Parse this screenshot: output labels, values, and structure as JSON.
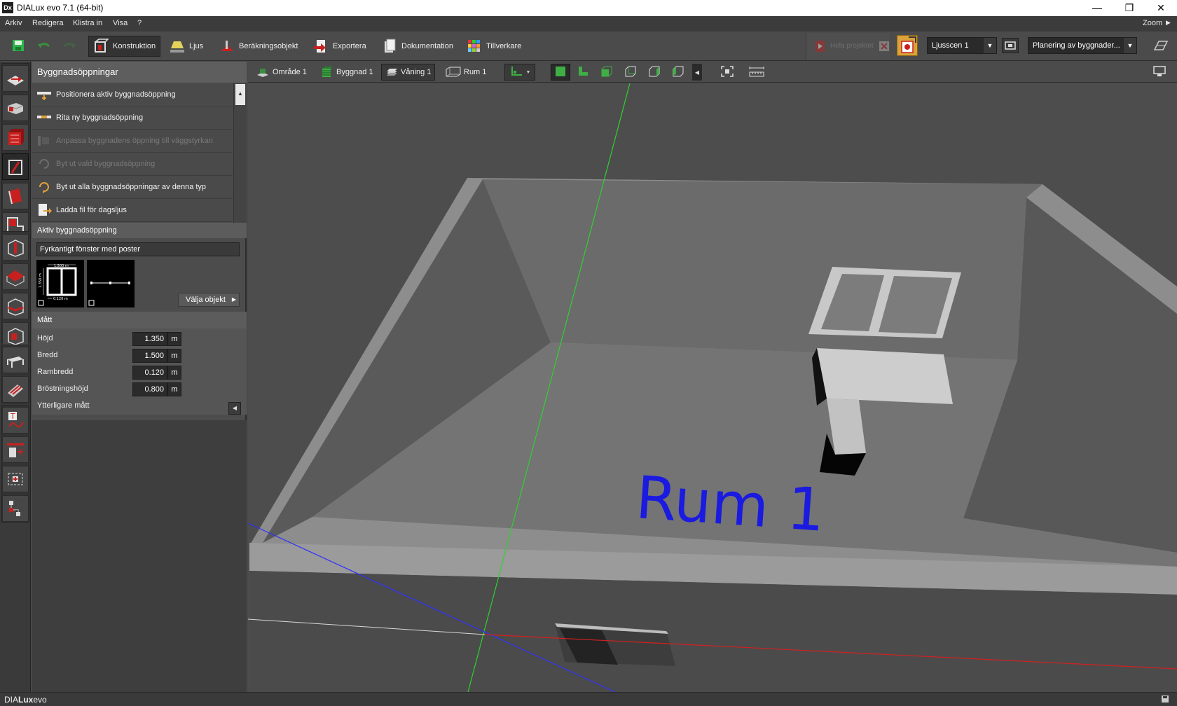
{
  "window": {
    "app_icon": "Dx",
    "title": "DIALux evo 7.1  (64-bit)",
    "minimize": "—",
    "maximize": "❐",
    "close": "✕"
  },
  "menu": {
    "items": [
      "Arkiv",
      "Redigera",
      "Klistra in",
      "Visa",
      "?"
    ],
    "zoom": "Zoom"
  },
  "toolbar": {
    "tabs": [
      {
        "label": "Konstruktion",
        "icon": "construction-icon"
      },
      {
        "label": "Ljus",
        "icon": "lamp-icon"
      },
      {
        "label": "Beräkningsobjekt",
        "icon": "calc-object-icon"
      },
      {
        "label": "Exportera",
        "icon": "export-icon"
      },
      {
        "label": "Dokumentation",
        "icon": "document-icon"
      },
      {
        "label": "Tillverkare",
        "icon": "manufacturer-icon"
      }
    ],
    "calc_label": "Hela projektet",
    "light_scene": "Ljusscen 1",
    "planning": "Planering av byggnader..."
  },
  "panel": {
    "title": "Byggnadsöppningar",
    "actions": [
      {
        "label": "Positionera aktiv byggnadsöppning",
        "enabled": true
      },
      {
        "label": "Rita ny byggnadsöppning",
        "enabled": true
      },
      {
        "label": "Anpassa byggnadens öppning till väggstyrkan",
        "enabled": false
      },
      {
        "label": "Byt ut vald byggnadsöppning",
        "enabled": false
      },
      {
        "label": "Byt ut alla byggnadsöppningar av denna typ",
        "enabled": true
      },
      {
        "label": "Ladda fil för dagsljus",
        "enabled": true
      }
    ],
    "active_section": "Aktiv byggnadsöppning",
    "active_name": "Fyrkantigt fönster med poster",
    "thumb_width_label": "1.500 m",
    "thumb_height_label": "1.350 m",
    "thumb_frame_label": "0.120 m",
    "choose_button": "Välja objekt",
    "dimensions_section": "Mått",
    "dimensions": [
      {
        "label": "Höjd",
        "value": "1.350",
        "unit": "m"
      },
      {
        "label": "Bredd",
        "value": "1.500",
        "unit": "m"
      },
      {
        "label": "Rambredd",
        "value": "0.120",
        "unit": "m"
      },
      {
        "label": "Bröstningshöjd",
        "value": "0.800",
        "unit": "m"
      }
    ],
    "more_dimensions": "Ytterligare mått"
  },
  "viewbar": {
    "crumbs": [
      {
        "label": "Område 1",
        "icon": "area-icon"
      },
      {
        "label": "Byggnad 1",
        "icon": "building-icon"
      },
      {
        "label": "Våning 1",
        "icon": "floor-icon"
      },
      {
        "label": "Rum 1",
        "icon": "room-icon"
      }
    ]
  },
  "viewport": {
    "room_label": "Rum 1"
  },
  "status": {
    "brand_a": "DIA",
    "brand_b": "Lux",
    "brand_c": "evo"
  },
  "colors": {
    "room_label": "#1a1ae0",
    "axis_x": "#d42020",
    "axis_y": "#2fd12f",
    "axis_z": "#3030ff",
    "accent_red": "#c8201e"
  }
}
